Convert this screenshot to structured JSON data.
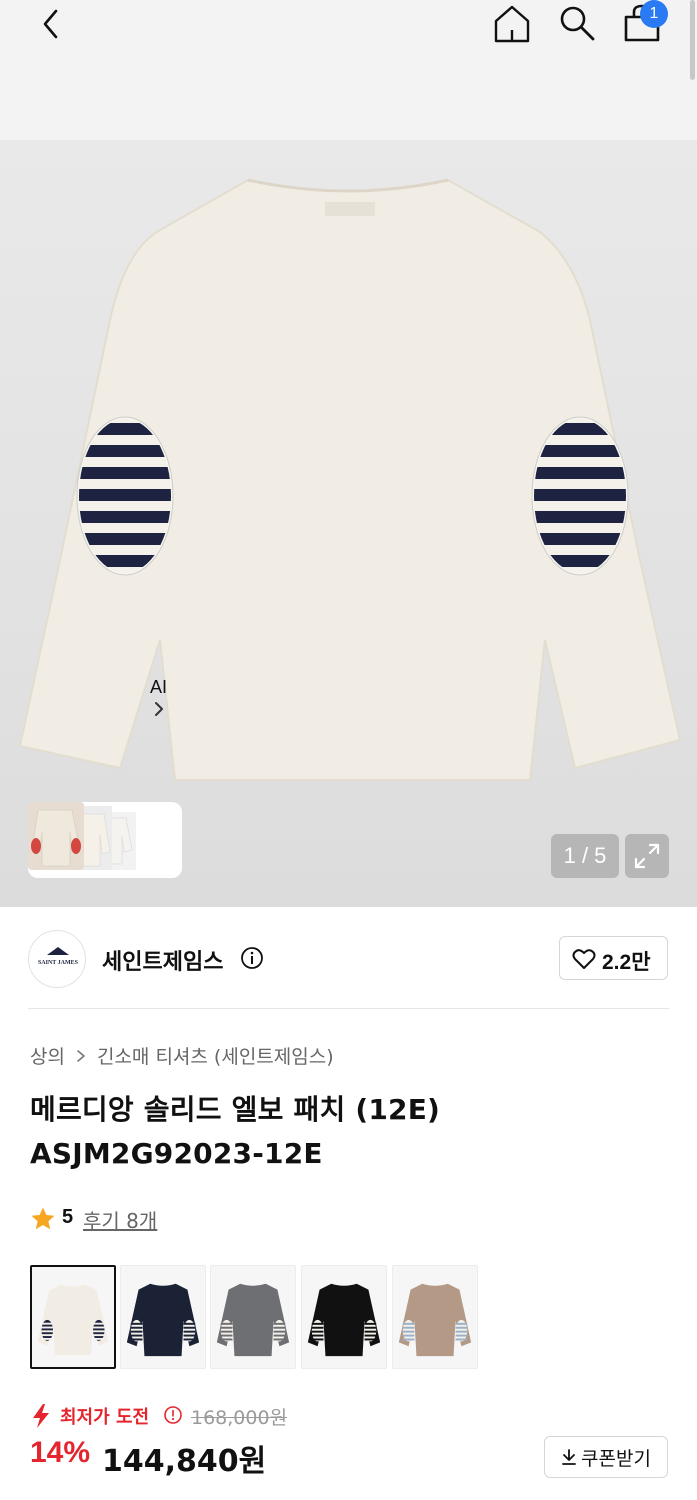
{
  "header": {
    "icons": [
      "back-icon",
      "home-icon",
      "search-icon",
      "cart-icon"
    ],
    "cart_count": "1"
  },
  "gallery": {
    "ai_label": "AI",
    "counter": "1 / 5",
    "colors": {
      "shirt": "#f1ede4",
      "patch_navy": "#1d2340"
    }
  },
  "brand": {
    "name": "세인트제임스",
    "logo_text": "SAINT JAMES",
    "likes": "2.2만"
  },
  "breadcrumb": {
    "category": "상의",
    "subcategory": "긴소매 티셔츠 (세인트제임스)"
  },
  "product": {
    "title": "메르디앙 솔리드 엘보 패치 (12E) ASJM2G92023-12E"
  },
  "rating": {
    "score": "5",
    "review_link": "후기 8개"
  },
  "color_options": [
    {
      "name": "ecru",
      "body": "#f1ede4",
      "patch": "#1d2340",
      "stripe": "#f4f1ea",
      "selected": true
    },
    {
      "name": "navy",
      "body": "#1c2236",
      "patch": "#f4f1ea",
      "stripe": "#1c2236",
      "selected": false
    },
    {
      "name": "grey",
      "body": "#6e6f72",
      "patch": "#f4f1ea",
      "stripe": "#6e6f72",
      "selected": false
    },
    {
      "name": "black",
      "body": "#111111",
      "patch": "#f4f1ea",
      "stripe": "#111111",
      "selected": false
    },
    {
      "name": "beige",
      "body": "#b49a86",
      "patch": "#f4f1ea",
      "stripe": "#9cb0c8",
      "selected": false
    }
  ],
  "price": {
    "promo_label": "최저가 도전",
    "original": "168,000원",
    "discount": "14%",
    "sale": "144,840원",
    "coupon_label": "쿠폰받기",
    "accent": "#e5252d"
  }
}
